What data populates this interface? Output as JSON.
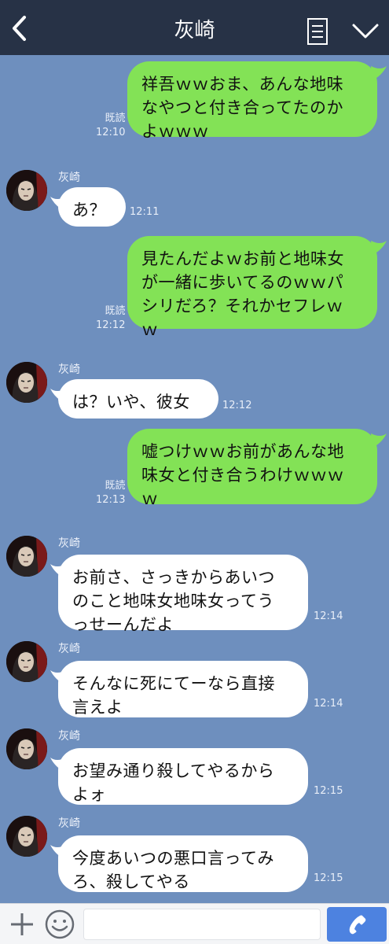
{
  "header": {
    "title": "灰崎"
  },
  "icons": {
    "back": "chevron-left-icon",
    "notes": "notes-icon",
    "menu": "chevron-down-icon",
    "plus": "plus-icon",
    "emoji": "smiley-icon",
    "call": "phone-icon"
  },
  "colors": {
    "background": "#6e8fbe",
    "header": "#273246",
    "outgoing_bubble": "#83e256",
    "incoming_bubble": "#ffffff",
    "call_button": "#4d82e0"
  },
  "messages": [
    {
      "dir": "out",
      "lines": [
        "祥吾ｗｗおま、あんな地味",
        "なやつと付き合ってたのか",
        "よｗｗｗ"
      ],
      "read": "既読",
      "time": "12:10"
    },
    {
      "dir": "in",
      "sender": "灰崎",
      "lines": [
        "あ？"
      ],
      "time": "12:11"
    },
    {
      "dir": "out",
      "lines": [
        "見たんだよｗお前と地味女",
        "が一緒に歩いてるのｗｗパ",
        "シリだろ？それかセフレｗ",
        "ｗ"
      ],
      "read": "既読",
      "time": "12:12"
    },
    {
      "dir": "in",
      "sender": "灰崎",
      "lines": [
        "は？いや、彼女"
      ],
      "time": "12:12"
    },
    {
      "dir": "out",
      "lines": [
        "嘘つけｗｗお前があんな地",
        "味女と付き合うわけｗｗｗ",
        "ｗ"
      ],
      "read": "既読",
      "time": "12:13"
    },
    {
      "dir": "in",
      "sender": "灰崎",
      "lines": [
        "お前さ、さっきからあいつ",
        "のこと地味女地味女ってう",
        "っせーんだよ"
      ],
      "time": "12:14"
    },
    {
      "dir": "in",
      "sender": "灰崎",
      "lines": [
        "そんなに死にてーなら直接",
        "言えよ"
      ],
      "time": "12:14"
    },
    {
      "dir": "in",
      "sender": "灰崎",
      "lines": [
        "お望み通り殺してやるから",
        "よォ"
      ],
      "time": "12:15"
    },
    {
      "dir": "in",
      "sender": "灰崎",
      "lines": [
        "今度あいつの悪口言ってみ",
        "ろ、殺してやる"
      ],
      "time": "12:15"
    }
  ],
  "input": {
    "placeholder": "",
    "value": ""
  }
}
